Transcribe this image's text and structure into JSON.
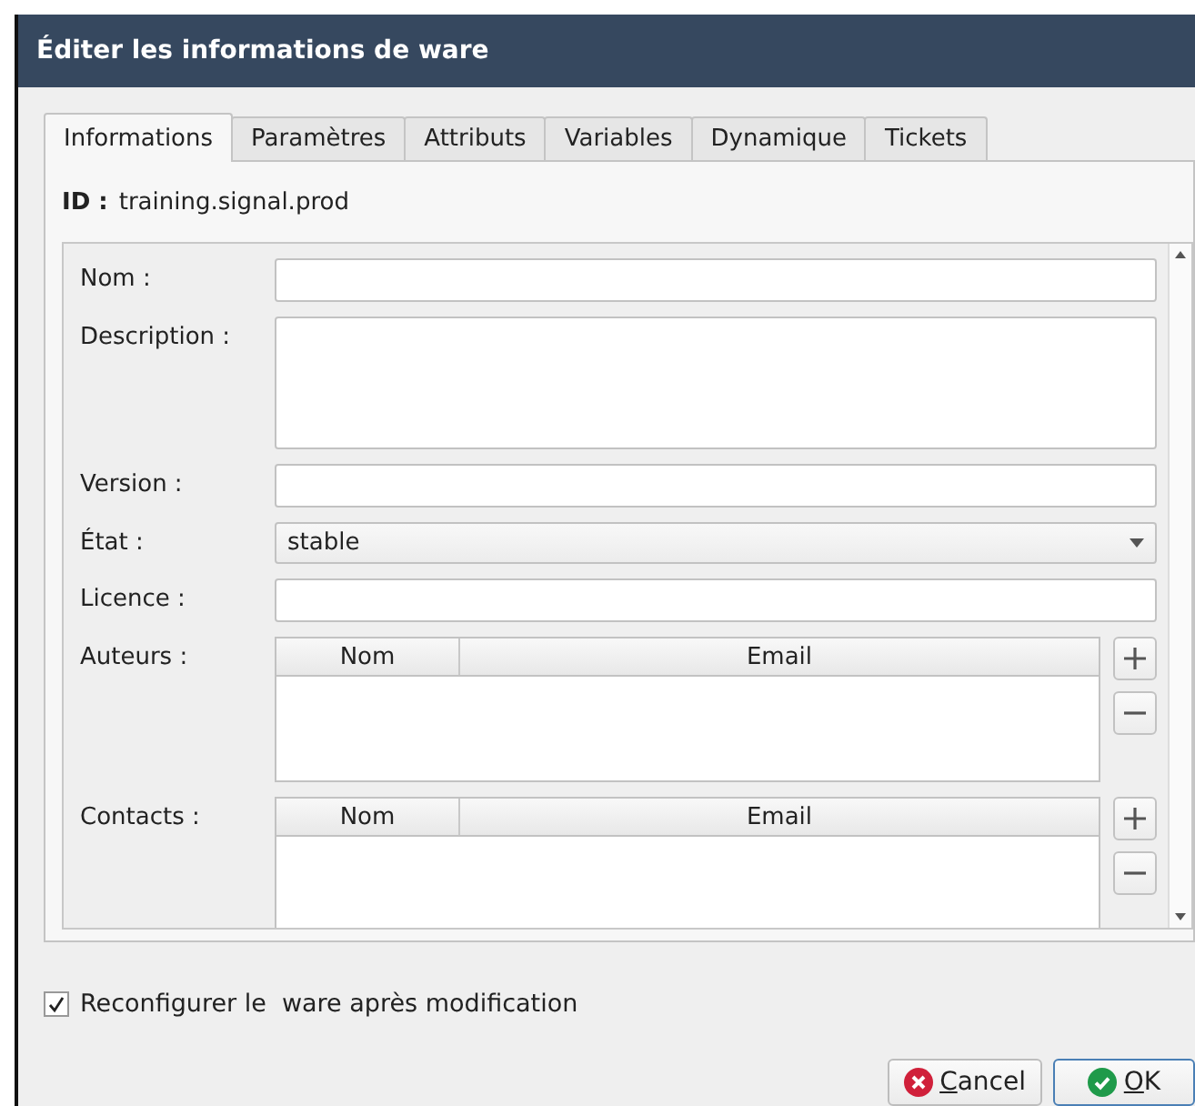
{
  "window": {
    "title": "Éditer les informations de ware"
  },
  "tabs": [
    {
      "label": "Informations",
      "selected": true
    },
    {
      "label": "Paramètres",
      "selected": false
    },
    {
      "label": "Attributs",
      "selected": false
    },
    {
      "label": "Variables",
      "selected": false
    },
    {
      "label": "Dynamique",
      "selected": false
    },
    {
      "label": "Tickets",
      "selected": false
    }
  ],
  "id": {
    "label": "ID :",
    "value": "training.signal.prod"
  },
  "fields": [
    {
      "kind": "text",
      "label": "Nom :"
    },
    {
      "kind": "textarea",
      "label": "Description :"
    },
    {
      "kind": "text",
      "label": "Version :"
    },
    {
      "kind": "select",
      "label": "État :",
      "value": "stable"
    },
    {
      "kind": "text",
      "label": "Licence :"
    },
    {
      "kind": "table",
      "label": "Auteurs :",
      "columns": [
        "Nom",
        "Email"
      ]
    },
    {
      "kind": "table",
      "label": "Contacts :",
      "columns": [
        "Nom",
        "Email"
      ]
    }
  ],
  "reconfigure": {
    "label": "Reconfigurer le  ware après modification",
    "checked": true
  },
  "buttons": [
    {
      "kind": "cancel",
      "label": "Cancel"
    },
    {
      "kind": "ok",
      "label": "OK"
    }
  ]
}
